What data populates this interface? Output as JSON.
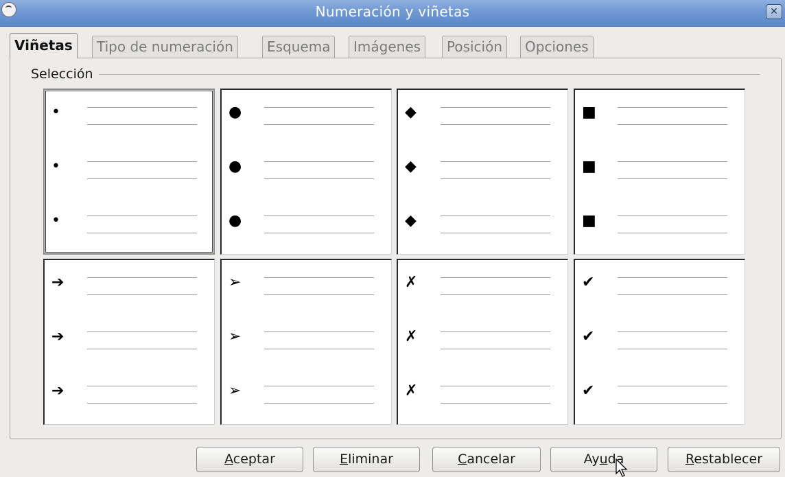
{
  "window": {
    "title": "Numeración y viñetas",
    "close_label": "✕"
  },
  "tabs": [
    {
      "label": "Viñetas",
      "active": true
    },
    {
      "label": "Tipo de numeración",
      "active": false
    },
    {
      "label": "Esquema",
      "active": false
    },
    {
      "label": "Imágenes",
      "active": false
    },
    {
      "label": "Posición",
      "active": false
    },
    {
      "label": "Opciones",
      "active": false
    }
  ],
  "section": {
    "legend": "Selección"
  },
  "bullets": [
    {
      "symbol": "•",
      "name": "small-dot",
      "selected": true
    },
    {
      "symbol": "●",
      "name": "large-dot",
      "selected": false
    },
    {
      "symbol": "◆",
      "name": "diamond",
      "selected": false
    },
    {
      "symbol": "■",
      "name": "square",
      "selected": false
    },
    {
      "symbol": "➔",
      "name": "arrow",
      "selected": false
    },
    {
      "symbol": "➢",
      "name": "arrowhead",
      "selected": false
    },
    {
      "symbol": "✗",
      "name": "cross",
      "selected": false
    },
    {
      "symbol": "✔",
      "name": "checkmark",
      "selected": false
    }
  ],
  "buttons": {
    "accept": {
      "mnemonic": "A",
      "rest": "ceptar"
    },
    "delete": {
      "mnemonic": "E",
      "rest": "liminar"
    },
    "cancel": {
      "mnemonic": "C",
      "rest": "ancelar"
    },
    "help": {
      "pre": "Ay",
      "mnemonic": "u",
      "rest": "da"
    },
    "reset": {
      "mnemonic": "R",
      "rest": "establecer"
    }
  }
}
